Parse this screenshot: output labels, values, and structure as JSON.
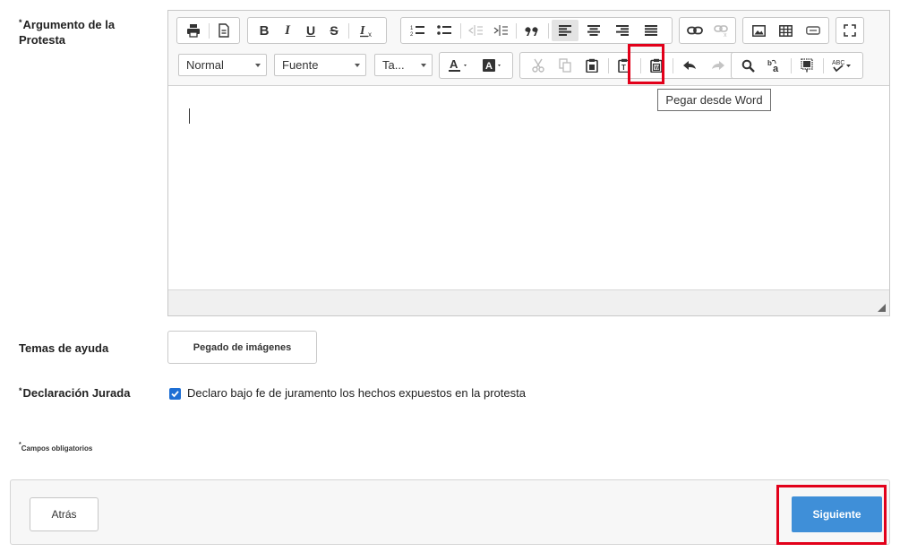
{
  "form": {
    "argument_label": "Argumento de la Protesta",
    "required_mark": "*",
    "help_label": "Temas de ayuda",
    "help_button": "Pegado de imágenes",
    "declaration_label": "Declaración Jurada",
    "declaration_text": "Declaro bajo fe de juramento los hechos expuestos en la protesta",
    "declaration_checked": true,
    "required_note": "Campos obligatorios"
  },
  "editor": {
    "format_combo": "Normal",
    "font_combo": "Fuente",
    "size_combo": "Ta...",
    "bold": "B",
    "italic": "I",
    "underline": "U",
    "strike": "S",
    "tooltip": "Pegar desde Word",
    "content": ""
  },
  "footer": {
    "back_label": "Atrás",
    "next_label": "Siguiente"
  },
  "colors": {
    "accent": "#3f8fd8",
    "highlight": "#e2001a",
    "checkbox": "#1e6fd4"
  },
  "icons": [
    "print-icon",
    "preview-icon",
    "bold-icon",
    "italic-icon",
    "underline-icon",
    "strikethrough-icon",
    "remove-format-icon",
    "numbered-list-icon",
    "bulleted-list-icon",
    "outdent-icon",
    "indent-icon",
    "blockquote-icon",
    "align-left-icon",
    "align-center-icon",
    "align-right-icon",
    "justify-icon",
    "link-icon",
    "unlink-icon",
    "image-icon",
    "table-icon",
    "horizontal-line-icon",
    "maximize-icon",
    "text-color-icon",
    "bg-color-icon",
    "cut-icon",
    "copy-icon",
    "paste-icon",
    "paste-text-icon",
    "paste-word-icon",
    "undo-icon",
    "redo-icon",
    "find-icon",
    "replace-icon",
    "select-all-icon",
    "spellcheck-icon",
    "resize-handle-icon",
    "check-icon"
  ]
}
